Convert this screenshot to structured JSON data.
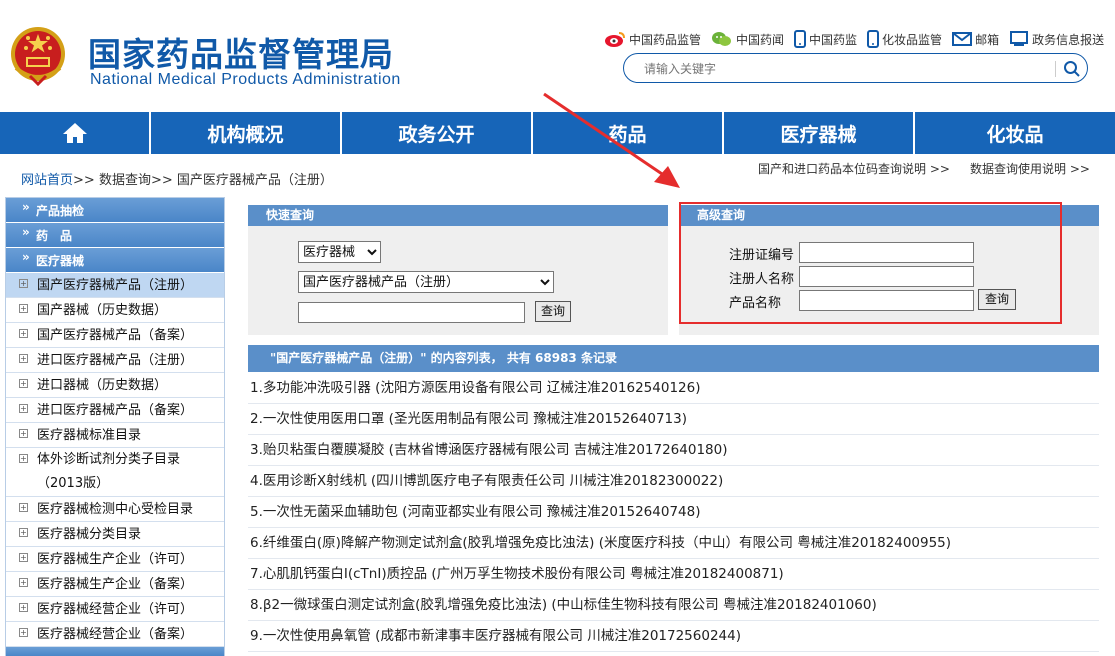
{
  "header": {
    "title_cn": "国家药品监督管理局",
    "title_en": "National Medical Products Administration",
    "top_links": [
      {
        "label": "中国药品监管",
        "icon": "weibo-icon"
      },
      {
        "label": "中国药闻",
        "icon": "wechat-icon"
      },
      {
        "label": "中国药监",
        "icon": "phone-icon"
      },
      {
        "label": "化妆品监管",
        "icon": "phone-icon"
      },
      {
        "label": "邮箱",
        "icon": "mail-icon"
      },
      {
        "label": "政务信息报送",
        "icon": "monitor-icon"
      }
    ],
    "search_placeholder": "请输入关键字"
  },
  "nav": {
    "items": [
      "机构概况",
      "政务公开",
      "药品",
      "医疗器械",
      "化妆品"
    ]
  },
  "breadcrumb": {
    "home": "网站首页",
    "sep": ">>",
    "level1": "数据查询",
    "current": "国产医疗器械产品（注册）"
  },
  "right_links": {
    "link1": "国产和进口药品本位码查询说明 >>",
    "link2": "数据查询使用说明 >>"
  },
  "sidebar": {
    "headers": [
      "产品抽检",
      "药　品",
      "医疗器械"
    ],
    "items": [
      "国产医疗器械产品（注册）",
      "国产器械（历史数据）",
      "国产医疗器械产品（备案）",
      "进口医疗器械产品（注册）",
      "进口器械（历史数据）",
      "进口医疗器械产品（备案）",
      "医疗器械标准目录",
      "体外诊断试剂分类子目录（2013版）",
      "医疗器械检测中心受检目录",
      "医疗器械分类目录",
      "医疗器械生产企业（许可）",
      "医疗器械生产企业（备案）",
      "医疗器械经营企业（许可）",
      "医疗器械经营企业（备案）"
    ]
  },
  "quick_search": {
    "title": "快速查询",
    "category_value": "医疗器械",
    "subcategory_value": "国产医疗器械产品（注册）",
    "keyword_value": "",
    "button": "查询"
  },
  "advanced_search": {
    "title": "高级查询",
    "field1_label": "注册证编号",
    "field2_label": "注册人名称",
    "field3_label": "产品名称",
    "button": "查询"
  },
  "list": {
    "header": "\"国产医疗器械产品（注册）\" 的内容列表，  共有  68983  条记录",
    "rows": [
      "1.多功能冲洗吸引器 (沈阳方源医用设备有限公司 辽械注准20162540126)",
      "2.一次性使用医用口罩 (圣光医用制品有限公司 豫械注准20152640713)",
      "3.贻贝粘蛋白覆膜凝胶 (吉林省博涵医疗器械有限公司 吉械注准20172640180)",
      "4.医用诊断X射线机 (四川博凯医疗电子有限责任公司 川械注准20182300022)",
      "5.一次性无菌采血辅助包 (河南亚都实业有限公司 豫械注准20152640748)",
      "6.纤维蛋白(原)降解产物测定试剂盒(胶乳增强免疫比浊法) (米度医疗科技（中山）有限公司 粤械注准20182400955)",
      "7.心肌肌钙蛋白I(cTnI)质控品 (广州万孚生物技术股份有限公司 粤械注准20182400871)",
      "8.β2一微球蛋白测定试剂盒(胶乳增强免疫比浊法) (中山标佳生物科技有限公司 粤械注准20182401060)",
      "9.一次性使用鼻氧管 (成都市新津事丰医疗器械有限公司 川械注准20172560244)"
    ]
  },
  "colors": {
    "brand_blue": "#1059a8",
    "nav_blue": "#1765b8",
    "panel_blue": "#5a8fc9",
    "annotation_red": "#e52d2d"
  }
}
